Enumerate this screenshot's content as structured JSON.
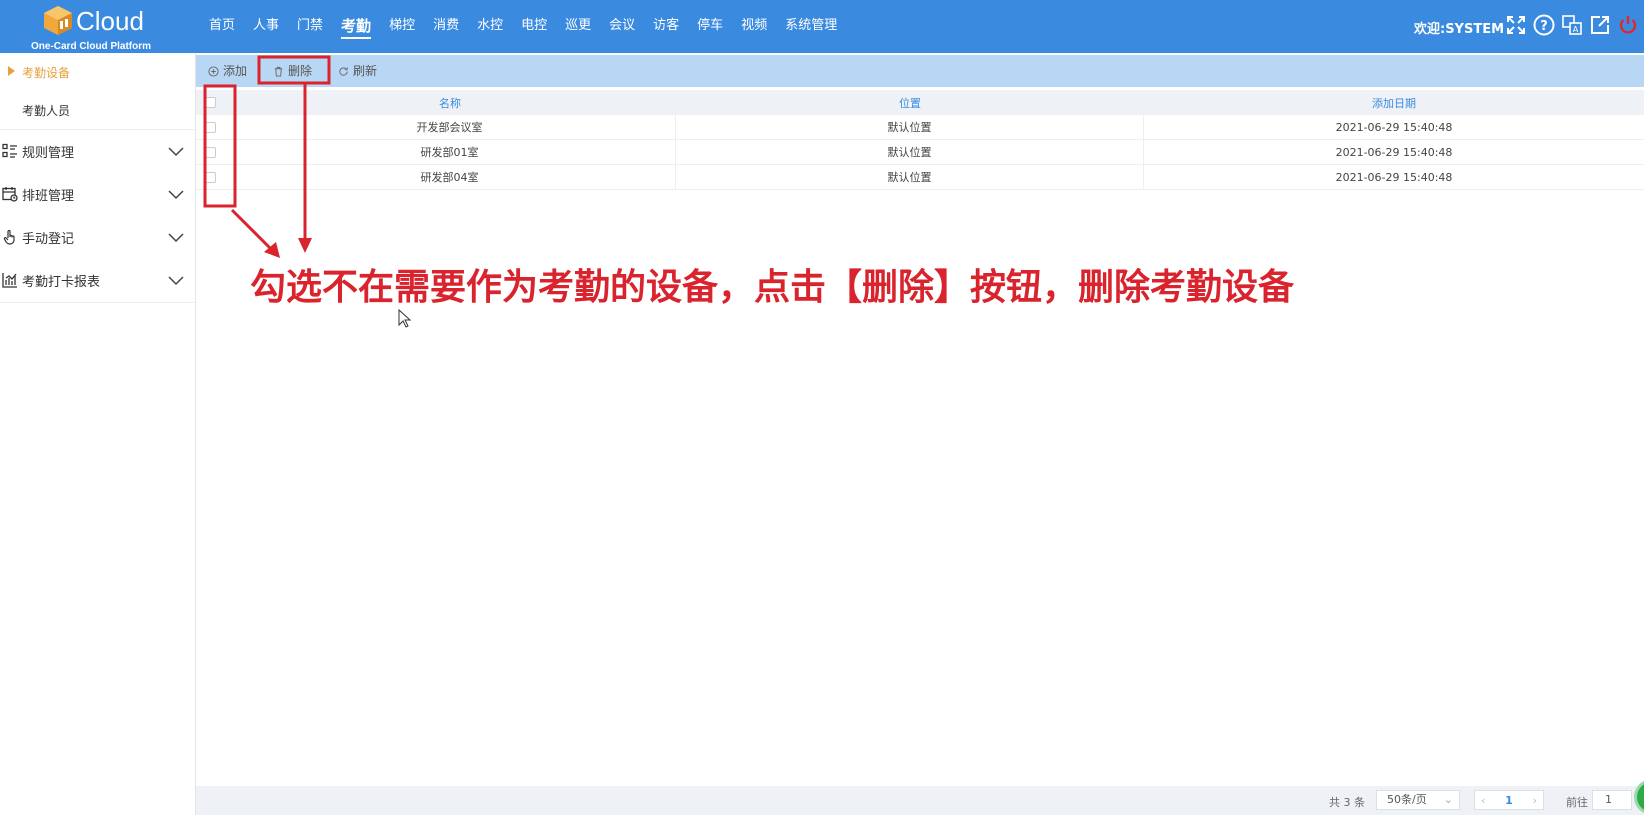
{
  "header": {
    "logo_text": "Cloud",
    "logo_sub": "One-Card Cloud Platform",
    "nav": [
      "首页",
      "人事",
      "门禁",
      "考勤",
      "梯控",
      "消费",
      "水控",
      "电控",
      "巡更",
      "会议",
      "访客",
      "停车",
      "视频",
      "系统管理"
    ],
    "active_nav": "考勤",
    "welcome": "欢迎:SYSTEM",
    "icons": [
      "fullscreen-icon",
      "help-icon",
      "translate-icon",
      "external-link-icon",
      "power-icon"
    ],
    "color": "#3a8ae0"
  },
  "sidebar": {
    "items": [
      {
        "label": "考勤设备",
        "active": true
      },
      {
        "label": "考勤人员",
        "active": false
      }
    ],
    "groups": [
      {
        "label": "规则管理",
        "icon": "rules-icon"
      },
      {
        "label": "排班管理",
        "icon": "calendar-icon"
      },
      {
        "label": "手动登记",
        "icon": "hand-icon"
      },
      {
        "label": "考勤打卡报表",
        "icon": "chart-icon"
      }
    ]
  },
  "toolbar": {
    "add_label": "添加",
    "delete_label": "删除",
    "refresh_label": "刷新"
  },
  "table": {
    "columns": [
      "名称",
      "位置",
      "添加日期"
    ],
    "rows": [
      {
        "name": "开发部会议室",
        "location": "默认位置",
        "date": "2021-06-29 15:40:48"
      },
      {
        "name": "研发部01室",
        "location": "默认位置",
        "date": "2021-06-29 15:40:48"
      },
      {
        "name": "研发部04室",
        "location": "默认位置",
        "date": "2021-06-29 15:40:48"
      }
    ]
  },
  "annotation": {
    "text": "勾选不在需要作为考勤的设备，点击【删除】按钮，删除考勤设备",
    "color": "#d9232d"
  },
  "pagination": {
    "total": "共 3 条",
    "page_size": "50条/页",
    "current_page": "1",
    "goto_label": "前往",
    "goto_value": "1"
  }
}
